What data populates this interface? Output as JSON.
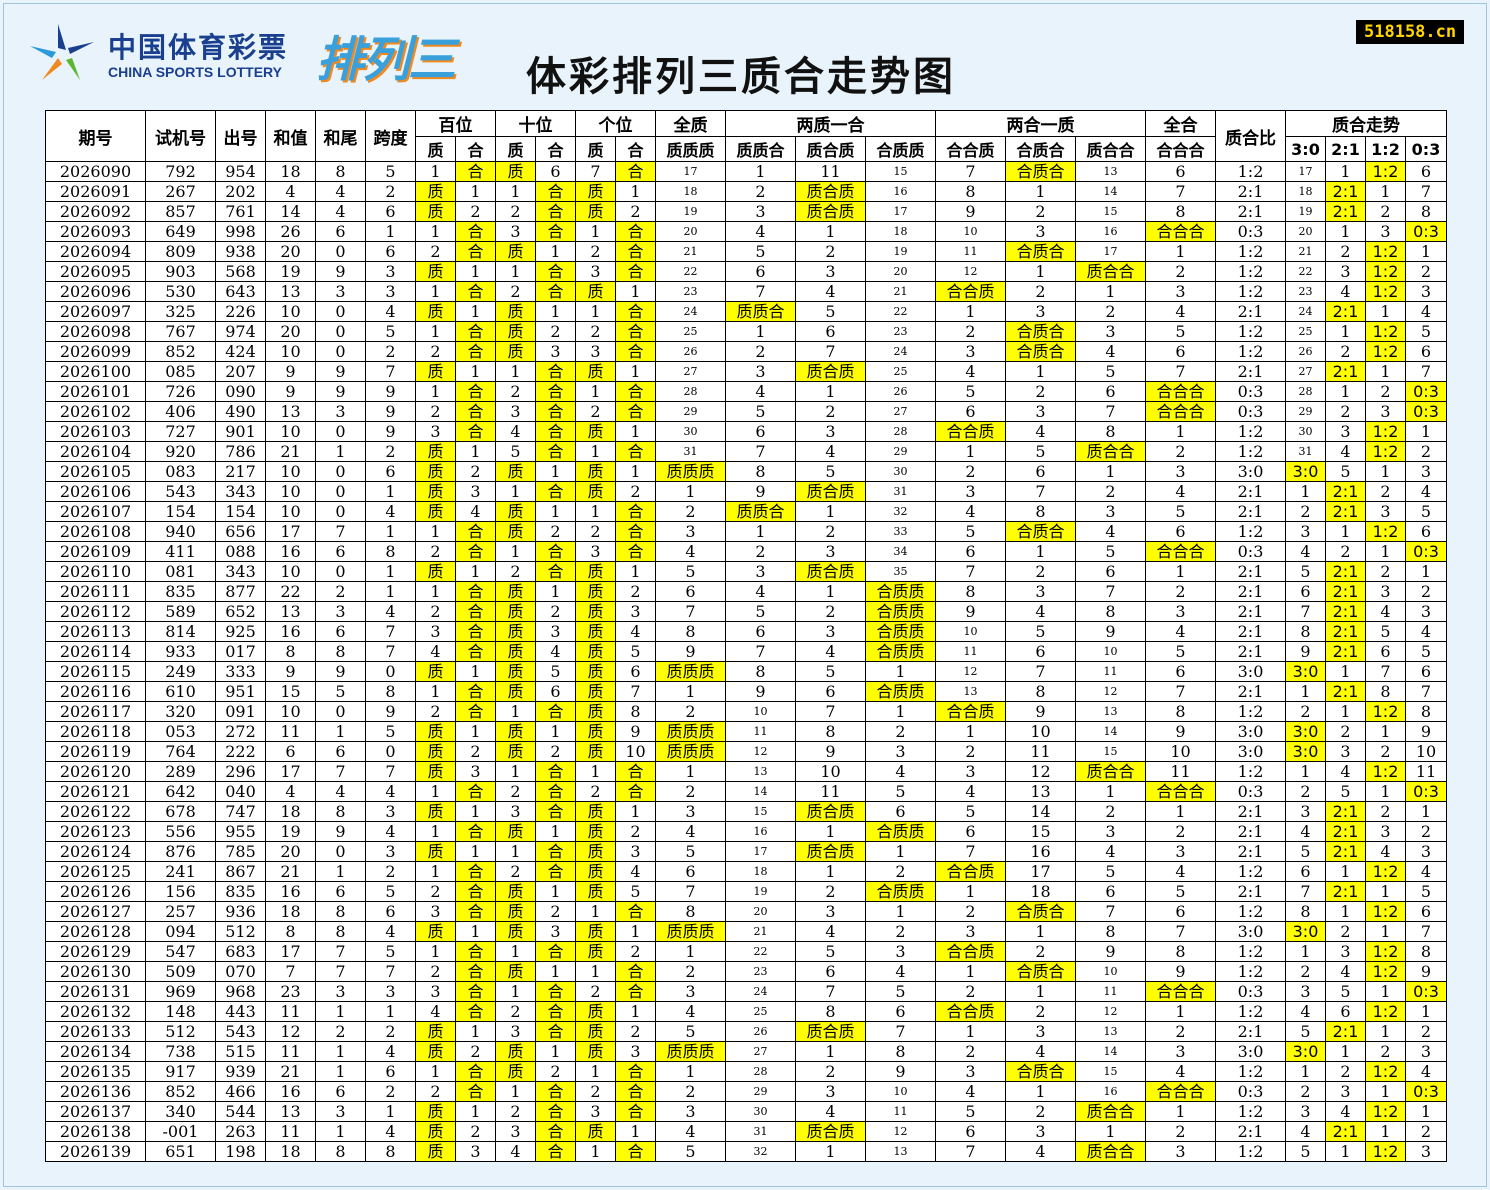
{
  "header": {
    "brand_cn": "中国体育彩票",
    "brand_en": "CHINA SPORTS LOTTERY",
    "game_logo": "排列三",
    "title": "体彩排列三质合走势图",
    "site": "518158.cn"
  },
  "colors": {
    "highlight": "#ffff00",
    "background": "#e8f3fb"
  },
  "columns": {
    "group": [
      "期号",
      "试机号",
      "出号",
      "和值",
      "和尾",
      "跨度",
      "百位",
      "十位",
      "个位",
      "全质",
      "两质一合",
      "两合一质",
      "全合",
      "质合比",
      "质合走势"
    ],
    "sub": [
      "质",
      "合",
      "质",
      "合",
      "质",
      "合",
      "质质质",
      "质质合",
      "质合质",
      "合质质",
      "合合质",
      "合质合",
      "质合合",
      "合合合",
      "3:0",
      "2:1",
      "1:2",
      "0:3"
    ]
  },
  "chart_data": {
    "type": "table",
    "rows": [
      [
        "2026090",
        "792",
        "954",
        "18",
        "8",
        "5",
        "1",
        "合",
        "质",
        "6",
        "7",
        "合",
        "17",
        "1",
        "11",
        "15",
        "7",
        "合质合",
        "13",
        "6",
        "1:2",
        "17",
        "1",
        "1:2",
        "6"
      ],
      [
        "2026091",
        "267",
        "202",
        "4",
        "4",
        "2",
        "质",
        "1",
        "1",
        "合",
        "质",
        "1",
        "18",
        "2",
        "质合质",
        "16",
        "8",
        "1",
        "14",
        "7",
        "2:1",
        "18",
        "2:1",
        "1",
        "7"
      ],
      [
        "2026092",
        "857",
        "761",
        "14",
        "4",
        "6",
        "质",
        "2",
        "2",
        "合",
        "质",
        "2",
        "19",
        "3",
        "质合质",
        "17",
        "9",
        "2",
        "15",
        "8",
        "2:1",
        "19",
        "2:1",
        "2",
        "8"
      ],
      [
        "2026093",
        "649",
        "998",
        "26",
        "6",
        "1",
        "1",
        "合",
        "3",
        "合",
        "1",
        "合",
        "20",
        "4",
        "1",
        "18",
        "10",
        "3",
        "16",
        "合合合",
        "0:3",
        "20",
        "1",
        "3",
        "0:3"
      ],
      [
        "2026094",
        "809",
        "938",
        "20",
        "0",
        "6",
        "2",
        "合",
        "质",
        "1",
        "2",
        "合",
        "21",
        "5",
        "2",
        "19",
        "11",
        "合质合",
        "17",
        "1",
        "1:2",
        "21",
        "2",
        "1:2",
        "1"
      ],
      [
        "2026095",
        "903",
        "568",
        "19",
        "9",
        "3",
        "质",
        "1",
        "1",
        "合",
        "3",
        "合",
        "22",
        "6",
        "3",
        "20",
        "12",
        "1",
        "质合合",
        "2",
        "1:2",
        "22",
        "3",
        "1:2",
        "2"
      ],
      [
        "2026096",
        "530",
        "643",
        "13",
        "3",
        "3",
        "1",
        "合",
        "2",
        "合",
        "质",
        "1",
        "23",
        "7",
        "4",
        "21",
        "合合质",
        "2",
        "1",
        "3",
        "1:2",
        "23",
        "4",
        "1:2",
        "3"
      ],
      [
        "2026097",
        "325",
        "226",
        "10",
        "0",
        "4",
        "质",
        "1",
        "质",
        "1",
        "1",
        "合",
        "24",
        "质质合",
        "5",
        "22",
        "1",
        "3",
        "2",
        "4",
        "2:1",
        "24",
        "2:1",
        "1",
        "4"
      ],
      [
        "2026098",
        "767",
        "974",
        "20",
        "0",
        "5",
        "1",
        "合",
        "质",
        "2",
        "2",
        "合",
        "25",
        "1",
        "6",
        "23",
        "2",
        "合质合",
        "3",
        "5",
        "1:2",
        "25",
        "1",
        "1:2",
        "5"
      ],
      [
        "2026099",
        "852",
        "424",
        "10",
        "0",
        "2",
        "2",
        "合",
        "质",
        "3",
        "3",
        "合",
        "26",
        "2",
        "7",
        "24",
        "3",
        "合质合",
        "4",
        "6",
        "1:2",
        "26",
        "2",
        "1:2",
        "6"
      ],
      [
        "2026100",
        "085",
        "207",
        "9",
        "9",
        "7",
        "质",
        "1",
        "1",
        "合",
        "质",
        "1",
        "27",
        "3",
        "质合质",
        "25",
        "4",
        "1",
        "5",
        "7",
        "2:1",
        "27",
        "2:1",
        "1",
        "7"
      ],
      [
        "2026101",
        "726",
        "090",
        "9",
        "9",
        "9",
        "1",
        "合",
        "2",
        "合",
        "1",
        "合",
        "28",
        "4",
        "1",
        "26",
        "5",
        "2",
        "6",
        "合合合",
        "0:3",
        "28",
        "1",
        "2",
        "0:3"
      ],
      [
        "2026102",
        "406",
        "490",
        "13",
        "3",
        "9",
        "2",
        "合",
        "3",
        "合",
        "2",
        "合",
        "29",
        "5",
        "2",
        "27",
        "6",
        "3",
        "7",
        "合合合",
        "0:3",
        "29",
        "2",
        "3",
        "0:3"
      ],
      [
        "2026103",
        "727",
        "901",
        "10",
        "0",
        "9",
        "3",
        "合",
        "4",
        "合",
        "质",
        "1",
        "30",
        "6",
        "3",
        "28",
        "合合质",
        "4",
        "8",
        "1",
        "1:2",
        "30",
        "3",
        "1:2",
        "1"
      ],
      [
        "2026104",
        "920",
        "786",
        "21",
        "1",
        "2",
        "质",
        "1",
        "5",
        "合",
        "1",
        "合",
        "31",
        "7",
        "4",
        "29",
        "1",
        "5",
        "质合合",
        "2",
        "1:2",
        "31",
        "4",
        "1:2",
        "2"
      ],
      [
        "2026105",
        "083",
        "217",
        "10",
        "0",
        "6",
        "质",
        "2",
        "质",
        "1",
        "质",
        "1",
        "质质质",
        "8",
        "5",
        "30",
        "2",
        "6",
        "1",
        "3",
        "3:0",
        "3:0",
        "5",
        "1",
        "3"
      ],
      [
        "2026106",
        "543",
        "343",
        "10",
        "0",
        "1",
        "质",
        "3",
        "1",
        "合",
        "质",
        "2",
        "1",
        "9",
        "质合质",
        "31",
        "3",
        "7",
        "2",
        "4",
        "2:1",
        "1",
        "2:1",
        "2",
        "4"
      ],
      [
        "2026107",
        "154",
        "154",
        "10",
        "0",
        "4",
        "质",
        "4",
        "质",
        "1",
        "1",
        "合",
        "2",
        "质质合",
        "1",
        "32",
        "4",
        "8",
        "3",
        "5",
        "2:1",
        "2",
        "2:1",
        "3",
        "5"
      ],
      [
        "2026108",
        "940",
        "656",
        "17",
        "7",
        "1",
        "1",
        "合",
        "质",
        "2",
        "2",
        "合",
        "3",
        "1",
        "2",
        "33",
        "5",
        "合质合",
        "4",
        "6",
        "1:2",
        "3",
        "1",
        "1:2",
        "6"
      ],
      [
        "2026109",
        "411",
        "088",
        "16",
        "6",
        "8",
        "2",
        "合",
        "1",
        "合",
        "3",
        "合",
        "4",
        "2",
        "3",
        "34",
        "6",
        "1",
        "5",
        "合合合",
        "0:3",
        "4",
        "2",
        "1",
        "0:3"
      ],
      [
        "2026110",
        "081",
        "343",
        "10",
        "0",
        "1",
        "质",
        "1",
        "2",
        "合",
        "质",
        "1",
        "5",
        "3",
        "质合质",
        "35",
        "7",
        "2",
        "6",
        "1",
        "2:1",
        "5",
        "2:1",
        "2",
        "1"
      ],
      [
        "2026111",
        "835",
        "877",
        "22",
        "2",
        "1",
        "1",
        "合",
        "质",
        "1",
        "质",
        "2",
        "6",
        "4",
        "1",
        "合质质",
        "8",
        "3",
        "7",
        "2",
        "2:1",
        "6",
        "2:1",
        "3",
        "2"
      ],
      [
        "2026112",
        "589",
        "652",
        "13",
        "3",
        "4",
        "2",
        "合",
        "质",
        "2",
        "质",
        "3",
        "7",
        "5",
        "2",
        "合质质",
        "9",
        "4",
        "8",
        "3",
        "2:1",
        "7",
        "2:1",
        "4",
        "3"
      ],
      [
        "2026113",
        "814",
        "925",
        "16",
        "6",
        "7",
        "3",
        "合",
        "质",
        "3",
        "质",
        "4",
        "8",
        "6",
        "3",
        "合质质",
        "10",
        "5",
        "9",
        "4",
        "2:1",
        "8",
        "2:1",
        "5",
        "4"
      ],
      [
        "2026114",
        "933",
        "017",
        "8",
        "8",
        "7",
        "4",
        "合",
        "质",
        "4",
        "质",
        "5",
        "9",
        "7",
        "4",
        "合质质",
        "11",
        "6",
        "10",
        "5",
        "2:1",
        "9",
        "2:1",
        "6",
        "5"
      ],
      [
        "2026115",
        "249",
        "333",
        "9",
        "9",
        "0",
        "质",
        "1",
        "质",
        "5",
        "质",
        "6",
        "质质质",
        "8",
        "5",
        "1",
        "12",
        "7",
        "11",
        "6",
        "3:0",
        "3:0",
        "1",
        "7",
        "6"
      ],
      [
        "2026116",
        "610",
        "951",
        "15",
        "5",
        "8",
        "1",
        "合",
        "质",
        "6",
        "质",
        "7",
        "1",
        "9",
        "6",
        "合质质",
        "13",
        "8",
        "12",
        "7",
        "2:1",
        "1",
        "2:1",
        "8",
        "7"
      ],
      [
        "2026117",
        "320",
        "091",
        "10",
        "0",
        "9",
        "2",
        "合",
        "1",
        "合",
        "质",
        "8",
        "2",
        "10",
        "7",
        "1",
        "合合质",
        "9",
        "13",
        "8",
        "1:2",
        "2",
        "1",
        "1:2",
        "8"
      ],
      [
        "2026118",
        "053",
        "272",
        "11",
        "1",
        "5",
        "质",
        "1",
        "质",
        "1",
        "质",
        "9",
        "质质质",
        "11",
        "8",
        "2",
        "1",
        "10",
        "14",
        "9",
        "3:0",
        "3:0",
        "2",
        "1",
        "9"
      ],
      [
        "2026119",
        "764",
        "222",
        "6",
        "6",
        "0",
        "质",
        "2",
        "质",
        "2",
        "质",
        "10",
        "质质质",
        "12",
        "9",
        "3",
        "2",
        "11",
        "15",
        "10",
        "3:0",
        "3:0",
        "3",
        "2",
        "10"
      ],
      [
        "2026120",
        "289",
        "296",
        "17",
        "7",
        "7",
        "质",
        "3",
        "1",
        "合",
        "1",
        "合",
        "1",
        "13",
        "10",
        "4",
        "3",
        "12",
        "质合合",
        "11",
        "1:2",
        "1",
        "4",
        "1:2",
        "11"
      ],
      [
        "2026121",
        "642",
        "040",
        "4",
        "4",
        "4",
        "1",
        "合",
        "2",
        "合",
        "2",
        "合",
        "2",
        "14",
        "11",
        "5",
        "4",
        "13",
        "1",
        "合合合",
        "0:3",
        "2",
        "5",
        "1",
        "0:3"
      ],
      [
        "2026122",
        "678",
        "747",
        "18",
        "8",
        "3",
        "质",
        "1",
        "3",
        "合",
        "质",
        "1",
        "3",
        "15",
        "质合质",
        "6",
        "5",
        "14",
        "2",
        "1",
        "2:1",
        "3",
        "2:1",
        "2",
        "1"
      ],
      [
        "2026123",
        "556",
        "955",
        "19",
        "9",
        "4",
        "1",
        "合",
        "质",
        "1",
        "质",
        "2",
        "4",
        "16",
        "1",
        "合质质",
        "6",
        "15",
        "3",
        "2",
        "2:1",
        "4",
        "2:1",
        "3",
        "2"
      ],
      [
        "2026124",
        "876",
        "785",
        "20",
        "0",
        "3",
        "质",
        "1",
        "1",
        "合",
        "质",
        "3",
        "5",
        "17",
        "质合质",
        "1",
        "7",
        "16",
        "4",
        "3",
        "2:1",
        "5",
        "2:1",
        "4",
        "3"
      ],
      [
        "2026125",
        "241",
        "867",
        "21",
        "1",
        "2",
        "1",
        "合",
        "2",
        "合",
        "质",
        "4",
        "6",
        "18",
        "1",
        "2",
        "合合质",
        "17",
        "5",
        "4",
        "1:2",
        "6",
        "1",
        "1:2",
        "4"
      ],
      [
        "2026126",
        "156",
        "835",
        "16",
        "6",
        "5",
        "2",
        "合",
        "质",
        "1",
        "质",
        "5",
        "7",
        "19",
        "2",
        "合质质",
        "1",
        "18",
        "6",
        "5",
        "2:1",
        "7",
        "2:1",
        "1",
        "5"
      ],
      [
        "2026127",
        "257",
        "936",
        "18",
        "8",
        "6",
        "3",
        "合",
        "质",
        "2",
        "1",
        "合",
        "8",
        "20",
        "3",
        "1",
        "2",
        "合质合",
        "7",
        "6",
        "1:2",
        "8",
        "1",
        "1:2",
        "6"
      ],
      [
        "2026128",
        "094",
        "512",
        "8",
        "8",
        "4",
        "质",
        "1",
        "质",
        "3",
        "质",
        "1",
        "质质质",
        "21",
        "4",
        "2",
        "3",
        "1",
        "8",
        "7",
        "3:0",
        "3:0",
        "2",
        "1",
        "7"
      ],
      [
        "2026129",
        "547",
        "683",
        "17",
        "7",
        "5",
        "1",
        "合",
        "1",
        "合",
        "质",
        "2",
        "1",
        "22",
        "5",
        "3",
        "合合质",
        "2",
        "9",
        "8",
        "1:2",
        "1",
        "3",
        "1:2",
        "8"
      ],
      [
        "2026130",
        "509",
        "070",
        "7",
        "7",
        "7",
        "2",
        "合",
        "质",
        "1",
        "1",
        "合",
        "2",
        "23",
        "6",
        "4",
        "1",
        "合质合",
        "10",
        "9",
        "1:2",
        "2",
        "4",
        "1:2",
        "9"
      ],
      [
        "2026131",
        "969",
        "968",
        "23",
        "3",
        "3",
        "3",
        "合",
        "1",
        "合",
        "2",
        "合",
        "3",
        "24",
        "7",
        "5",
        "2",
        "1",
        "11",
        "合合合",
        "0:3",
        "3",
        "5",
        "1",
        "0:3"
      ],
      [
        "2026132",
        "148",
        "443",
        "11",
        "1",
        "1",
        "4",
        "合",
        "2",
        "合",
        "质",
        "1",
        "4",
        "25",
        "8",
        "6",
        "合合质",
        "2",
        "12",
        "1",
        "1:2",
        "4",
        "6",
        "1:2",
        "1"
      ],
      [
        "2026133",
        "512",
        "543",
        "12",
        "2",
        "2",
        "质",
        "1",
        "3",
        "合",
        "质",
        "2",
        "5",
        "26",
        "质合质",
        "7",
        "1",
        "3",
        "13",
        "2",
        "2:1",
        "5",
        "2:1",
        "1",
        "2"
      ],
      [
        "2026134",
        "738",
        "515",
        "11",
        "1",
        "4",
        "质",
        "2",
        "质",
        "1",
        "质",
        "3",
        "质质质",
        "27",
        "1",
        "8",
        "2",
        "4",
        "14",
        "3",
        "3:0",
        "3:0",
        "1",
        "2",
        "3"
      ],
      [
        "2026135",
        "917",
        "939",
        "21",
        "1",
        "6",
        "1",
        "合",
        "质",
        "2",
        "1",
        "合",
        "1",
        "28",
        "2",
        "9",
        "3",
        "合质合",
        "15",
        "4",
        "1:2",
        "1",
        "2",
        "1:2",
        "4"
      ],
      [
        "2026136",
        "852",
        "466",
        "16",
        "6",
        "2",
        "2",
        "合",
        "1",
        "合",
        "2",
        "合",
        "2",
        "29",
        "3",
        "10",
        "4",
        "1",
        "16",
        "合合合",
        "0:3",
        "2",
        "3",
        "1",
        "0:3"
      ],
      [
        "2026137",
        "340",
        "544",
        "13",
        "3",
        "1",
        "质",
        "1",
        "2",
        "合",
        "3",
        "合",
        "3",
        "30",
        "4",
        "11",
        "5",
        "2",
        "质合合",
        "1",
        "1:2",
        "3",
        "4",
        "1:2",
        "1"
      ],
      [
        "2026138",
        "-001",
        "263",
        "11",
        "1",
        "4",
        "质",
        "2",
        "3",
        "合",
        "质",
        "1",
        "4",
        "31",
        "质合质",
        "12",
        "6",
        "3",
        "1",
        "2",
        "2:1",
        "4",
        "2:1",
        "1",
        "2"
      ],
      [
        "2026139",
        "651",
        "198",
        "18",
        "8",
        "8",
        "质",
        "3",
        "4",
        "合",
        "1",
        "合",
        "5",
        "32",
        "1",
        "13",
        "7",
        "4",
        "质合合",
        "3",
        "1:2",
        "5",
        "1",
        "1:2",
        "3"
      ]
    ]
  }
}
